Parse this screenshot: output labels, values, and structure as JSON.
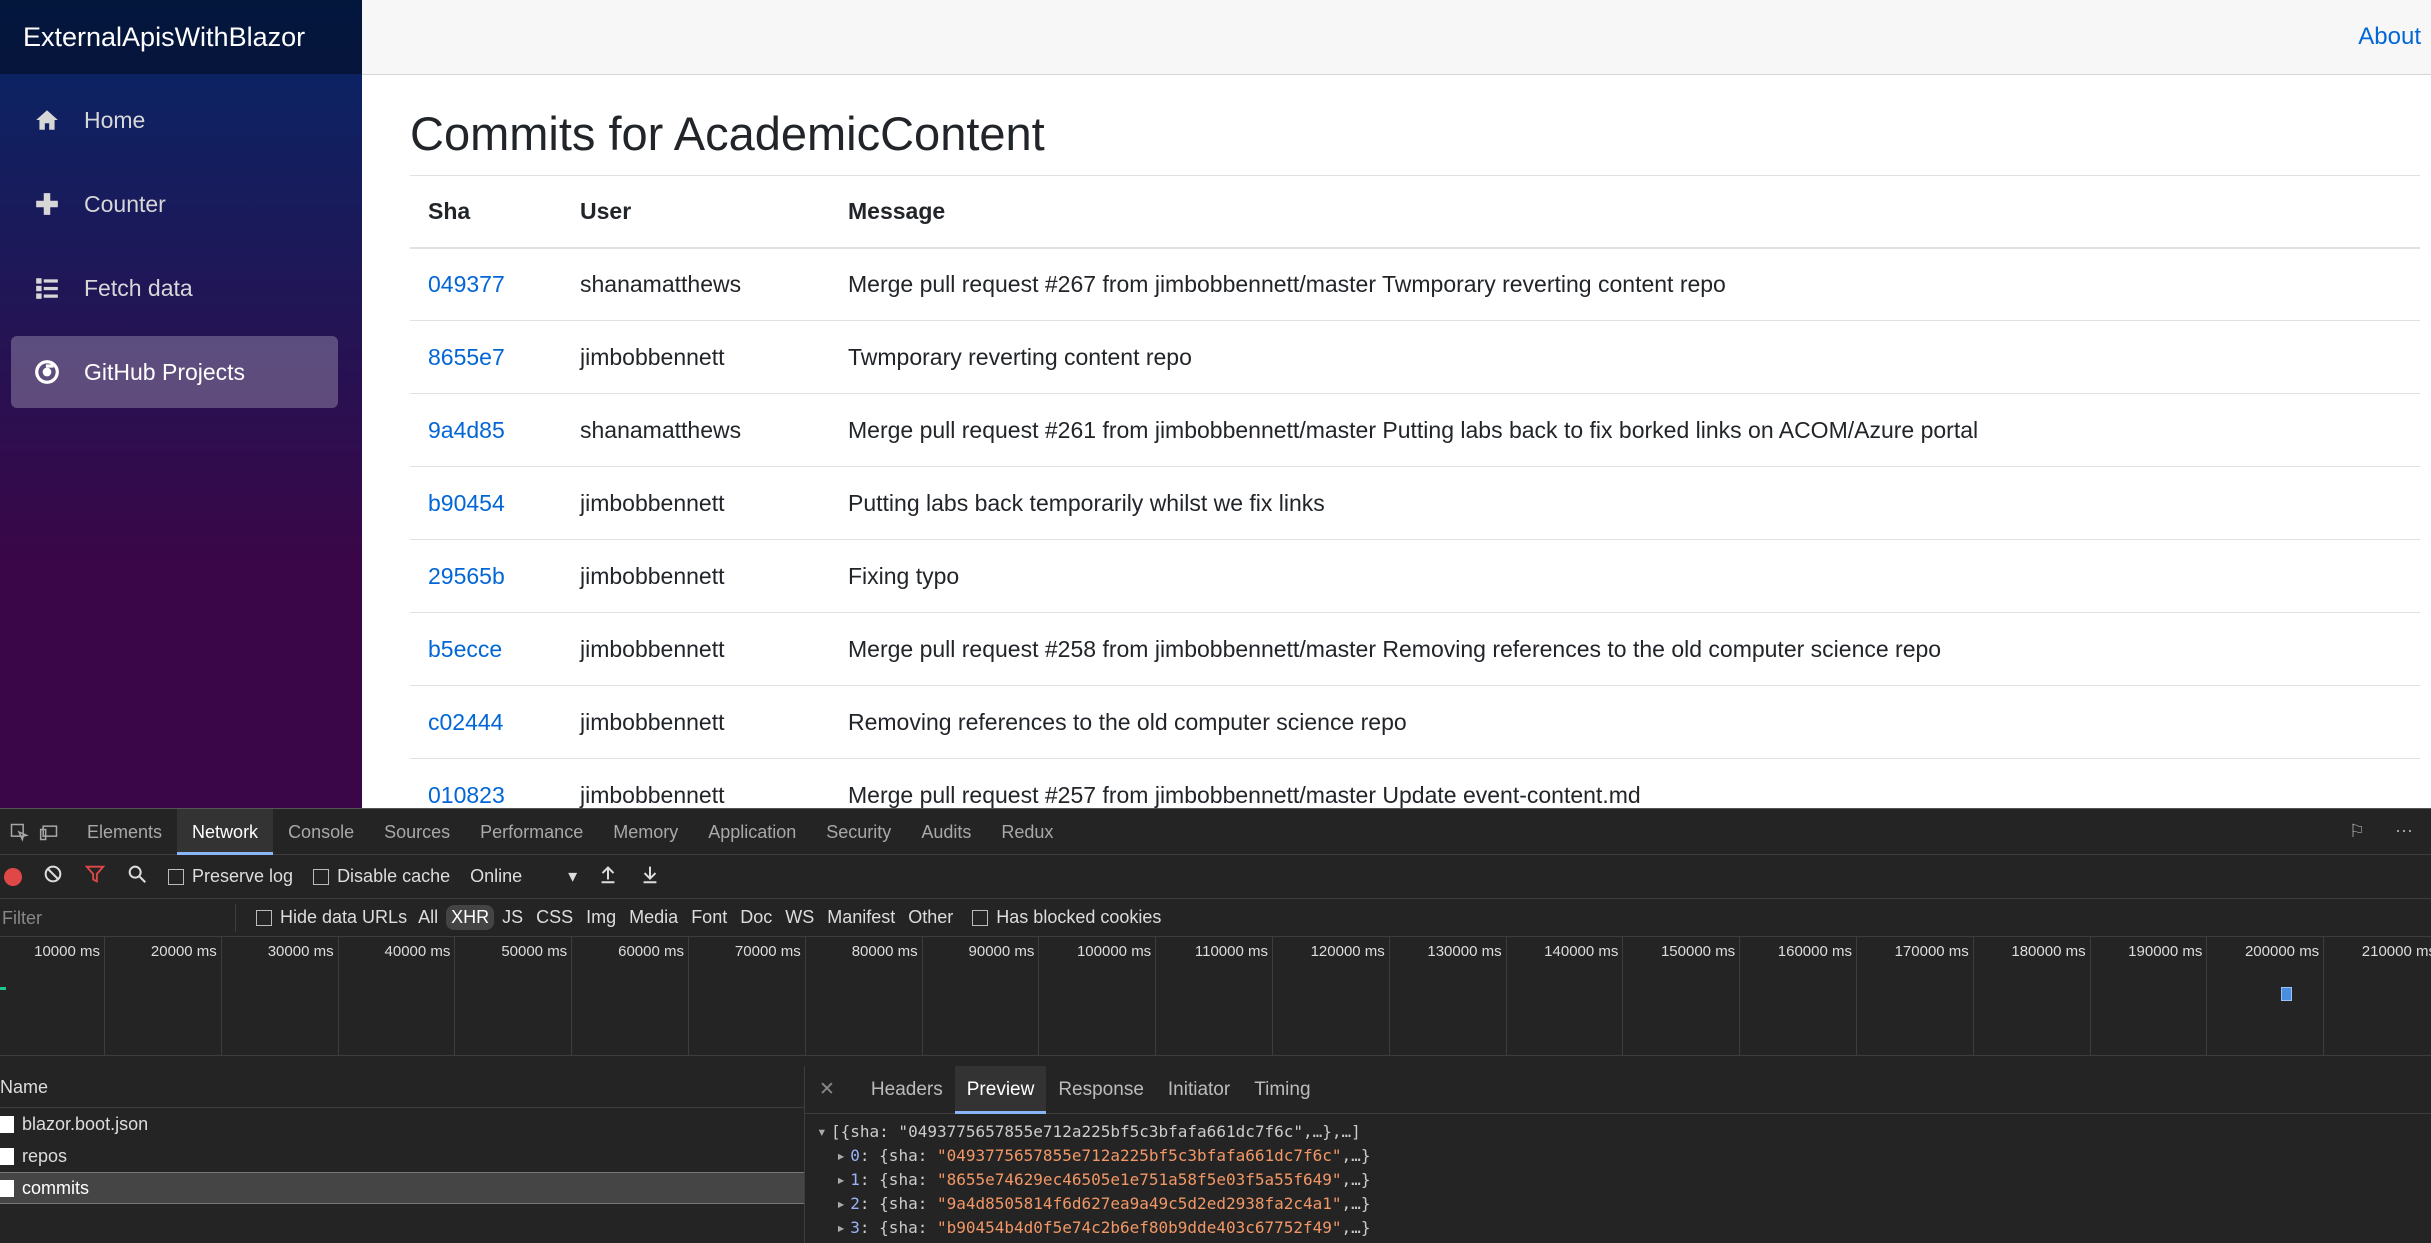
{
  "app": {
    "brand": "ExternalApisWithBlazor",
    "about_link": "About",
    "nav": [
      {
        "label": "Home",
        "icon": "home-icon"
      },
      {
        "label": "Counter",
        "icon": "plus-icon"
      },
      {
        "label": "Fetch data",
        "icon": "list-icon"
      },
      {
        "label": "GitHub Projects",
        "icon": "github-icon",
        "active": true
      }
    ]
  },
  "page": {
    "title": "Commits for AcademicContent",
    "columns": [
      "Sha",
      "User",
      "Message"
    ],
    "rows": [
      {
        "sha": "049377",
        "user": "shanamatthews",
        "message": "Merge pull request #267 from jimbobbennett/master Twmporary reverting content repo"
      },
      {
        "sha": "8655e7",
        "user": "jimbobbennett",
        "message": "Twmporary reverting content repo"
      },
      {
        "sha": "9a4d85",
        "user": "shanamatthews",
        "message": "Merge pull request #261 from jimbobbennett/master Putting labs back to fix borked links on ACOM/Azure portal"
      },
      {
        "sha": "b90454",
        "user": "jimbobbennett",
        "message": "Putting labs back temporarily whilst we fix links"
      },
      {
        "sha": "29565b",
        "user": "jimbobbennett",
        "message": "Fixing typo"
      },
      {
        "sha": "b5ecce",
        "user": "jimbobbennett",
        "message": "Merge pull request #258 from jimbobbennett/master Removing references to the old computer science repo"
      },
      {
        "sha": "c02444",
        "user": "jimbobbennett",
        "message": "Removing references to the old computer science repo"
      },
      {
        "sha": "010823",
        "user": "jimbobbennett",
        "message": "Merge pull request #257 from jimbobbennett/master Update event-content.md"
      }
    ]
  },
  "devtools": {
    "tabs": [
      "Elements",
      "Network",
      "Console",
      "Sources",
      "Performance",
      "Memory",
      "Application",
      "Security",
      "Audits",
      "Redux"
    ],
    "active_tab": "Network",
    "toolbar": {
      "preserve_log": "Preserve log",
      "disable_cache": "Disable cache",
      "throttle": "Online"
    },
    "filter": {
      "placeholder": "Filter",
      "hide_data_urls": "Hide data URLs",
      "types": [
        "All",
        "XHR",
        "JS",
        "CSS",
        "Img",
        "Media",
        "Font",
        "Doc",
        "WS",
        "Manifest",
        "Other"
      ],
      "active_type": "XHR",
      "blocked_cookies": "Has blocked cookies"
    },
    "timeline_ticks": [
      "10000 ms",
      "20000 ms",
      "30000 ms",
      "40000 ms",
      "50000 ms",
      "60000 ms",
      "70000 ms",
      "80000 ms",
      "90000 ms",
      "100000 ms",
      "110000 ms",
      "120000 ms",
      "130000 ms",
      "140000 ms",
      "150000 ms",
      "160000 ms",
      "170000 ms",
      "180000 ms",
      "190000 ms",
      "200000 ms",
      "210000 ms"
    ],
    "requests_header": "Name",
    "requests": [
      "blazor.boot.json",
      "repos",
      "commits"
    ],
    "selected_request": "commits",
    "detail_tabs": [
      "Headers",
      "Preview",
      "Response",
      "Initiator",
      "Timing"
    ],
    "active_detail_tab": "Preview",
    "preview": {
      "root": "[{sha: \"0493775657855e712a225bf5c3bfafa661dc7f6c\",…},…]",
      "items": [
        {
          "index": "0",
          "sha": "\"0493775657855e712a225bf5c3bfafa661dc7f6c\""
        },
        {
          "index": "1",
          "sha": "\"8655e74629ec46505e1e751a58f5e03f5a55f649\""
        },
        {
          "index": "2",
          "sha": "\"9a4d8505814f6d627ea9a49c5d2ed2938fa2c4a1\""
        },
        {
          "index": "3",
          "sha": "\"b90454b4d0f5e74c2b6ef80b9dde403c67752f49\""
        }
      ]
    }
  }
}
